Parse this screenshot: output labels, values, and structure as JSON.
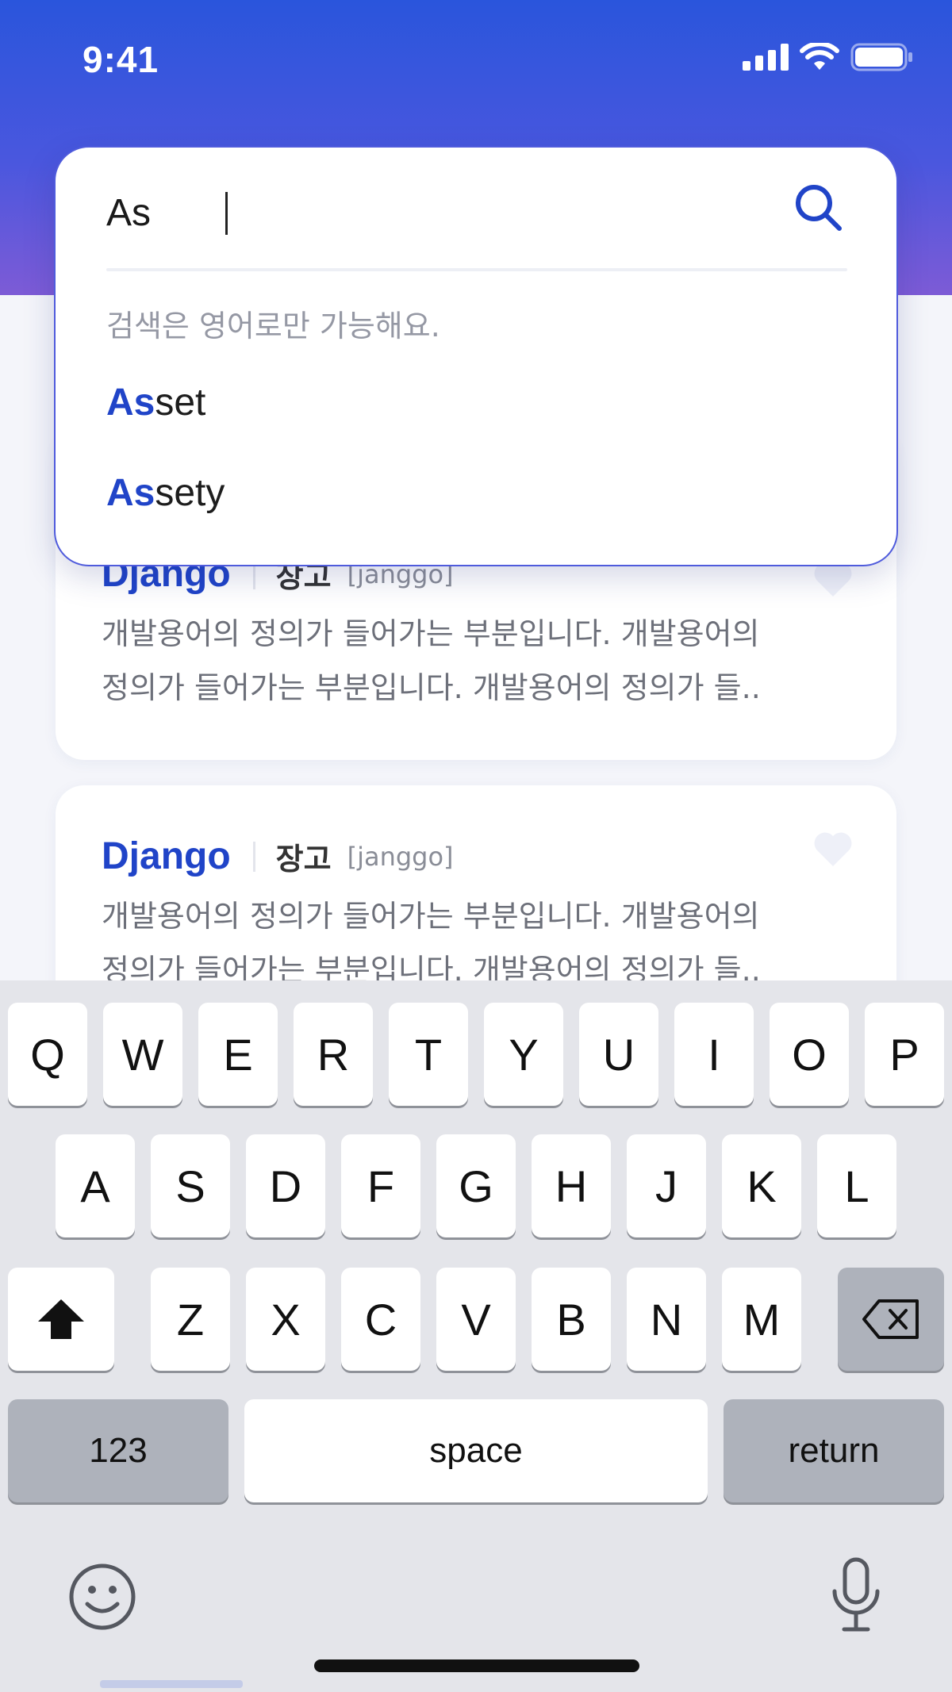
{
  "status_bar": {
    "time": "9:41"
  },
  "search": {
    "value": "As",
    "hint": "검색은 영어로만 가능해요.",
    "suggestions": [
      {
        "match": "As",
        "rest": "set"
      },
      {
        "match": "As",
        "rest": "sety"
      }
    ]
  },
  "cards": [
    {
      "term": "Django",
      "korean": "장고",
      "pronunciation": "[janggo]",
      "definition_line1": "개발용어의 정의가 들어가는 부분입니다. 개발용어의",
      "definition_line2": "정의가 들어가는 부분입니다. 개발용어의 정의가 들.."
    },
    {
      "term": "Django",
      "korean": "장고",
      "pronunciation": "[janggo]",
      "definition_line1": "개발용어의 정의가 들어가는 부분입니다. 개발용어의",
      "definition_line2": "정의가 들어가는 부분입니다. 개발용어의 정의가 들.."
    }
  ],
  "keyboard": {
    "row1": [
      "Q",
      "W",
      "E",
      "R",
      "T",
      "Y",
      "U",
      "I",
      "O",
      "P"
    ],
    "row2": [
      "A",
      "S",
      "D",
      "F",
      "G",
      "H",
      "J",
      "K",
      "L"
    ],
    "row3": [
      "Z",
      "X",
      "C",
      "V",
      "B",
      "N",
      "M"
    ],
    "numbers_label": "123",
    "space_label": "space",
    "return_label": "return"
  },
  "colors": {
    "accent": "#2044c8",
    "header_top": "#2a55dc",
    "header_bottom": "#7d5bd6",
    "panel_border": "#4f5bdc"
  }
}
